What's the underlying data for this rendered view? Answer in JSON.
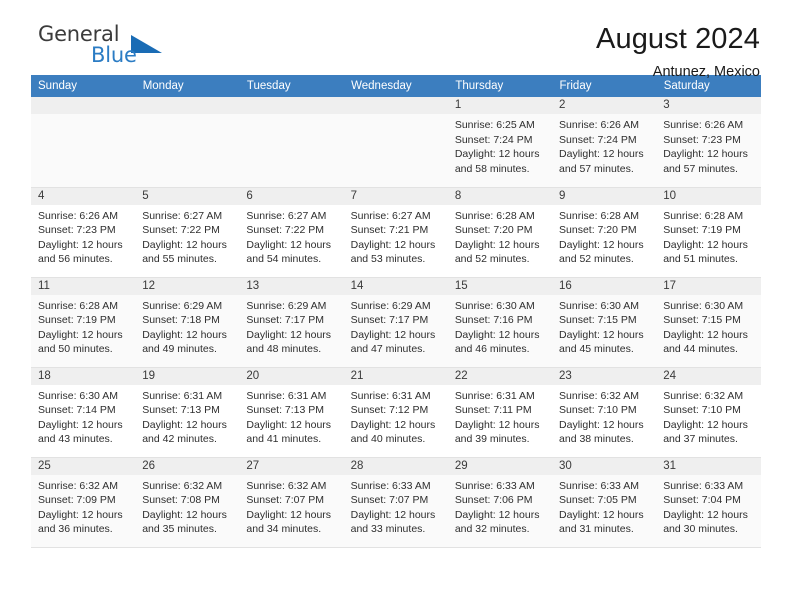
{
  "brand": {
    "name_top": "General",
    "name_bottom": "Blue",
    "triangle_color": "#1a6cb5",
    "text_color": "#3b3b3b",
    "blue_color": "#2b7cc4"
  },
  "header": {
    "title": "August 2024",
    "subtitle": "Antunez, Mexico"
  },
  "theme": {
    "header_bg": "#3c7ebf",
    "header_text": "#ffffff",
    "daynum_bg": "#efefef",
    "alt_row_bg": "#fafafa"
  },
  "weekdays": [
    "Sunday",
    "Monday",
    "Tuesday",
    "Wednesday",
    "Thursday",
    "Friday",
    "Saturday"
  ],
  "labels": {
    "sunrise_prefix": "Sunrise:",
    "sunset_prefix": "Sunset:",
    "daylight_prefix": "Daylight:"
  },
  "weeks": [
    [
      {
        "day": "",
        "empty": true
      },
      {
        "day": "",
        "empty": true
      },
      {
        "day": "",
        "empty": true
      },
      {
        "day": "",
        "empty": true
      },
      {
        "day": "1",
        "sunrise": "Sunrise: 6:25 AM",
        "sunset": "Sunset: 7:24 PM",
        "daylight_line1": "Daylight: 12 hours",
        "daylight_line2": "and 58 minutes."
      },
      {
        "day": "2",
        "sunrise": "Sunrise: 6:26 AM",
        "sunset": "Sunset: 7:24 PM",
        "daylight_line1": "Daylight: 12 hours",
        "daylight_line2": "and 57 minutes."
      },
      {
        "day": "3",
        "sunrise": "Sunrise: 6:26 AM",
        "sunset": "Sunset: 7:23 PM",
        "daylight_line1": "Daylight: 12 hours",
        "daylight_line2": "and 57 minutes."
      }
    ],
    [
      {
        "day": "4",
        "sunrise": "Sunrise: 6:26 AM",
        "sunset": "Sunset: 7:23 PM",
        "daylight_line1": "Daylight: 12 hours",
        "daylight_line2": "and 56 minutes."
      },
      {
        "day": "5",
        "sunrise": "Sunrise: 6:27 AM",
        "sunset": "Sunset: 7:22 PM",
        "daylight_line1": "Daylight: 12 hours",
        "daylight_line2": "and 55 minutes."
      },
      {
        "day": "6",
        "sunrise": "Sunrise: 6:27 AM",
        "sunset": "Sunset: 7:22 PM",
        "daylight_line1": "Daylight: 12 hours",
        "daylight_line2": "and 54 minutes."
      },
      {
        "day": "7",
        "sunrise": "Sunrise: 6:27 AM",
        "sunset": "Sunset: 7:21 PM",
        "daylight_line1": "Daylight: 12 hours",
        "daylight_line2": "and 53 minutes."
      },
      {
        "day": "8",
        "sunrise": "Sunrise: 6:28 AM",
        "sunset": "Sunset: 7:20 PM",
        "daylight_line1": "Daylight: 12 hours",
        "daylight_line2": "and 52 minutes."
      },
      {
        "day": "9",
        "sunrise": "Sunrise: 6:28 AM",
        "sunset": "Sunset: 7:20 PM",
        "daylight_line1": "Daylight: 12 hours",
        "daylight_line2": "and 52 minutes."
      },
      {
        "day": "10",
        "sunrise": "Sunrise: 6:28 AM",
        "sunset": "Sunset: 7:19 PM",
        "daylight_line1": "Daylight: 12 hours",
        "daylight_line2": "and 51 minutes."
      }
    ],
    [
      {
        "day": "11",
        "sunrise": "Sunrise: 6:28 AM",
        "sunset": "Sunset: 7:19 PM",
        "daylight_line1": "Daylight: 12 hours",
        "daylight_line2": "and 50 minutes."
      },
      {
        "day": "12",
        "sunrise": "Sunrise: 6:29 AM",
        "sunset": "Sunset: 7:18 PM",
        "daylight_line1": "Daylight: 12 hours",
        "daylight_line2": "and 49 minutes."
      },
      {
        "day": "13",
        "sunrise": "Sunrise: 6:29 AM",
        "sunset": "Sunset: 7:17 PM",
        "daylight_line1": "Daylight: 12 hours",
        "daylight_line2": "and 48 minutes."
      },
      {
        "day": "14",
        "sunrise": "Sunrise: 6:29 AM",
        "sunset": "Sunset: 7:17 PM",
        "daylight_line1": "Daylight: 12 hours",
        "daylight_line2": "and 47 minutes."
      },
      {
        "day": "15",
        "sunrise": "Sunrise: 6:30 AM",
        "sunset": "Sunset: 7:16 PM",
        "daylight_line1": "Daylight: 12 hours",
        "daylight_line2": "and 46 minutes."
      },
      {
        "day": "16",
        "sunrise": "Sunrise: 6:30 AM",
        "sunset": "Sunset: 7:15 PM",
        "daylight_line1": "Daylight: 12 hours",
        "daylight_line2": "and 45 minutes."
      },
      {
        "day": "17",
        "sunrise": "Sunrise: 6:30 AM",
        "sunset": "Sunset: 7:15 PM",
        "daylight_line1": "Daylight: 12 hours",
        "daylight_line2": "and 44 minutes."
      }
    ],
    [
      {
        "day": "18",
        "sunrise": "Sunrise: 6:30 AM",
        "sunset": "Sunset: 7:14 PM",
        "daylight_line1": "Daylight: 12 hours",
        "daylight_line2": "and 43 minutes."
      },
      {
        "day": "19",
        "sunrise": "Sunrise: 6:31 AM",
        "sunset": "Sunset: 7:13 PM",
        "daylight_line1": "Daylight: 12 hours",
        "daylight_line2": "and 42 minutes."
      },
      {
        "day": "20",
        "sunrise": "Sunrise: 6:31 AM",
        "sunset": "Sunset: 7:13 PM",
        "daylight_line1": "Daylight: 12 hours",
        "daylight_line2": "and 41 minutes."
      },
      {
        "day": "21",
        "sunrise": "Sunrise: 6:31 AM",
        "sunset": "Sunset: 7:12 PM",
        "daylight_line1": "Daylight: 12 hours",
        "daylight_line2": "and 40 minutes."
      },
      {
        "day": "22",
        "sunrise": "Sunrise: 6:31 AM",
        "sunset": "Sunset: 7:11 PM",
        "daylight_line1": "Daylight: 12 hours",
        "daylight_line2": "and 39 minutes."
      },
      {
        "day": "23",
        "sunrise": "Sunrise: 6:32 AM",
        "sunset": "Sunset: 7:10 PM",
        "daylight_line1": "Daylight: 12 hours",
        "daylight_line2": "and 38 minutes."
      },
      {
        "day": "24",
        "sunrise": "Sunrise: 6:32 AM",
        "sunset": "Sunset: 7:10 PM",
        "daylight_line1": "Daylight: 12 hours",
        "daylight_line2": "and 37 minutes."
      }
    ],
    [
      {
        "day": "25",
        "sunrise": "Sunrise: 6:32 AM",
        "sunset": "Sunset: 7:09 PM",
        "daylight_line1": "Daylight: 12 hours",
        "daylight_line2": "and 36 minutes."
      },
      {
        "day": "26",
        "sunrise": "Sunrise: 6:32 AM",
        "sunset": "Sunset: 7:08 PM",
        "daylight_line1": "Daylight: 12 hours",
        "daylight_line2": "and 35 minutes."
      },
      {
        "day": "27",
        "sunrise": "Sunrise: 6:32 AM",
        "sunset": "Sunset: 7:07 PM",
        "daylight_line1": "Daylight: 12 hours",
        "daylight_line2": "and 34 minutes."
      },
      {
        "day": "28",
        "sunrise": "Sunrise: 6:33 AM",
        "sunset": "Sunset: 7:07 PM",
        "daylight_line1": "Daylight: 12 hours",
        "daylight_line2": "and 33 minutes."
      },
      {
        "day": "29",
        "sunrise": "Sunrise: 6:33 AM",
        "sunset": "Sunset: 7:06 PM",
        "daylight_line1": "Daylight: 12 hours",
        "daylight_line2": "and 32 minutes."
      },
      {
        "day": "30",
        "sunrise": "Sunrise: 6:33 AM",
        "sunset": "Sunset: 7:05 PM",
        "daylight_line1": "Daylight: 12 hours",
        "daylight_line2": "and 31 minutes."
      },
      {
        "day": "31",
        "sunrise": "Sunrise: 6:33 AM",
        "sunset": "Sunset: 7:04 PM",
        "daylight_line1": "Daylight: 12 hours",
        "daylight_line2": "and 30 minutes."
      }
    ]
  ]
}
